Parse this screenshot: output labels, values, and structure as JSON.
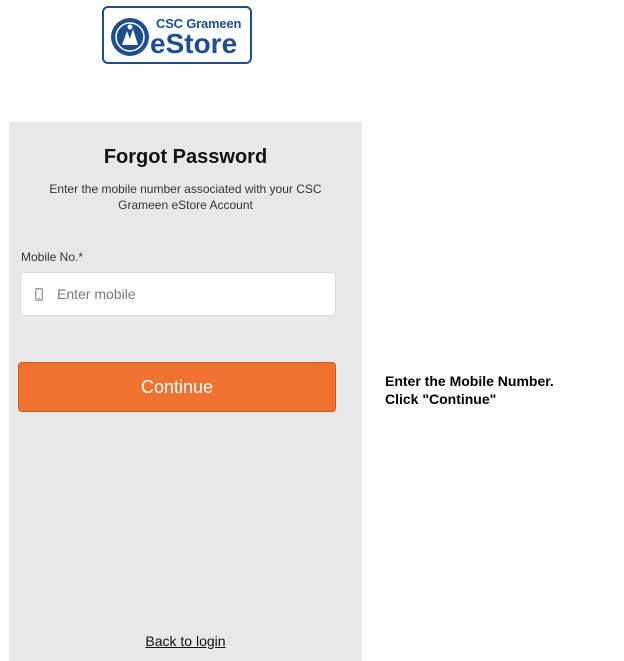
{
  "logo": {
    "line1": "CSC Grameen",
    "line2": "eStore",
    "brand_color": "#1f4e8c"
  },
  "form": {
    "title": "Forgot Password",
    "subtitle": "Enter the mobile number associated with your CSC Grameen eStore Account",
    "mobile_label": "Mobile No.*",
    "mobile_placeholder": "Enter mobile",
    "mobile_icon": "phone-icon",
    "continue_label": "Continue",
    "continue_color": "#f07230",
    "back_link": "Back to login",
    "panel_background": "#e8e8e8"
  },
  "instruction": {
    "line1": "Enter the Mobile Number.",
    "line2": "Click \"Continue\""
  }
}
